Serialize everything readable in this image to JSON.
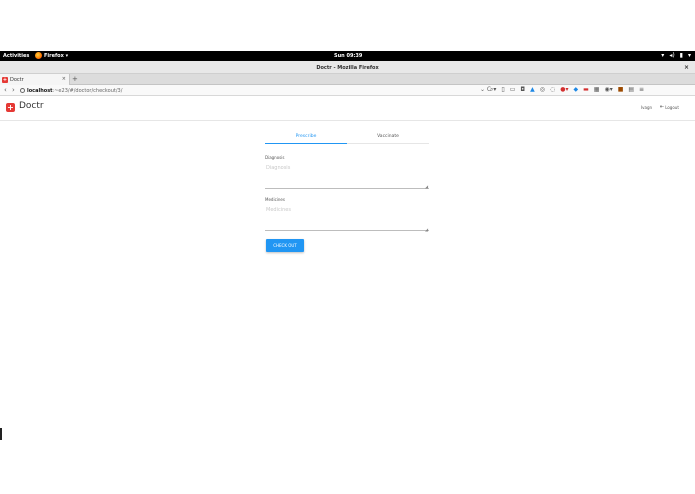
{
  "system": {
    "activities": "Activities",
    "app_name": "Firefox ▾",
    "clock": "Sun 09:39",
    "tray": [
      "wifi-icon",
      "volume-icon",
      "battery-icon",
      "power-menu-icon"
    ]
  },
  "window": {
    "title": "Doctr - Mozilla Firefox",
    "close": "×"
  },
  "browser": {
    "tab_label": "Doctr",
    "tab_close": "×",
    "new_tab": "+",
    "url_host": "localhost",
    "url_rest": ":~e23/#/doctor/checkout/3/",
    "url_right": "⌄ C",
    "back": "‹",
    "forward": "›"
  },
  "app": {
    "brand_icon": "+",
    "brand_name": "Doctr",
    "user": "Ivagn",
    "logout_label": "Logout",
    "accent_color": "#2196f3",
    "brand_color": "#e53935"
  },
  "form": {
    "tabs": [
      {
        "label": "Prescribe",
        "active": true
      },
      {
        "label": "Vaccinate",
        "active": false
      }
    ],
    "diagnosis": {
      "label": "Diagnosis",
      "placeholder": "Diagnosis",
      "value": ""
    },
    "medicines": {
      "label": "Medicines",
      "placeholder": "Medicines",
      "value": ""
    },
    "submit_label": "CHECK OUT"
  }
}
